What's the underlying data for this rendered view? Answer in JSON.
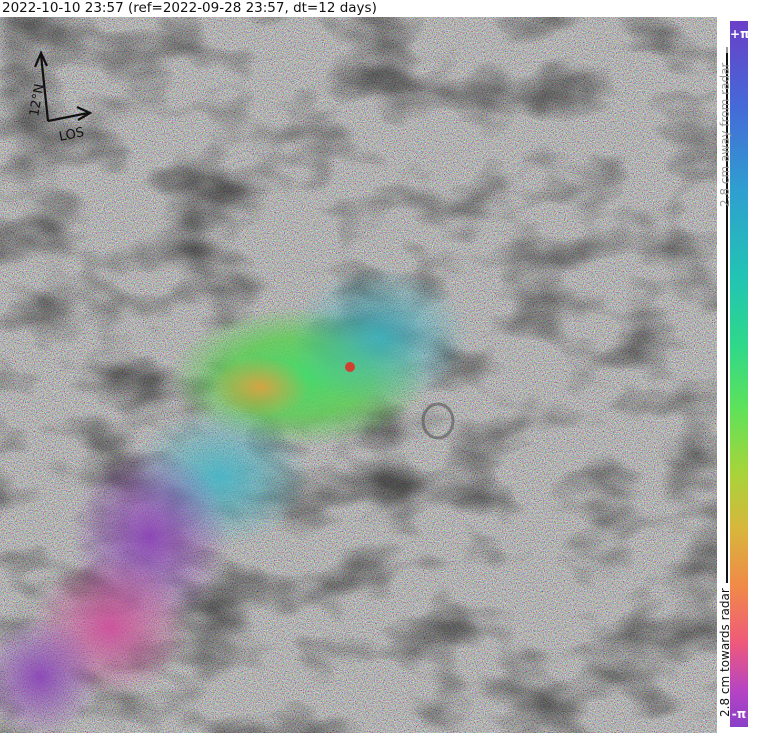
{
  "title": "2022-10-10 23:57 (ref=2022-09-28 23:57, dt=12 days)",
  "north_arrow": {
    "heading_label": "12°N",
    "los_label": "LOS"
  },
  "colorbar": {
    "top_label": "+π",
    "bottom_label": "-π",
    "away_label": "2.8 cm away from radar",
    "towards_label": "2.8 cm towards radar"
  },
  "colors": {
    "away_arrow": "#999999",
    "towards_arrow": "#000000"
  }
}
